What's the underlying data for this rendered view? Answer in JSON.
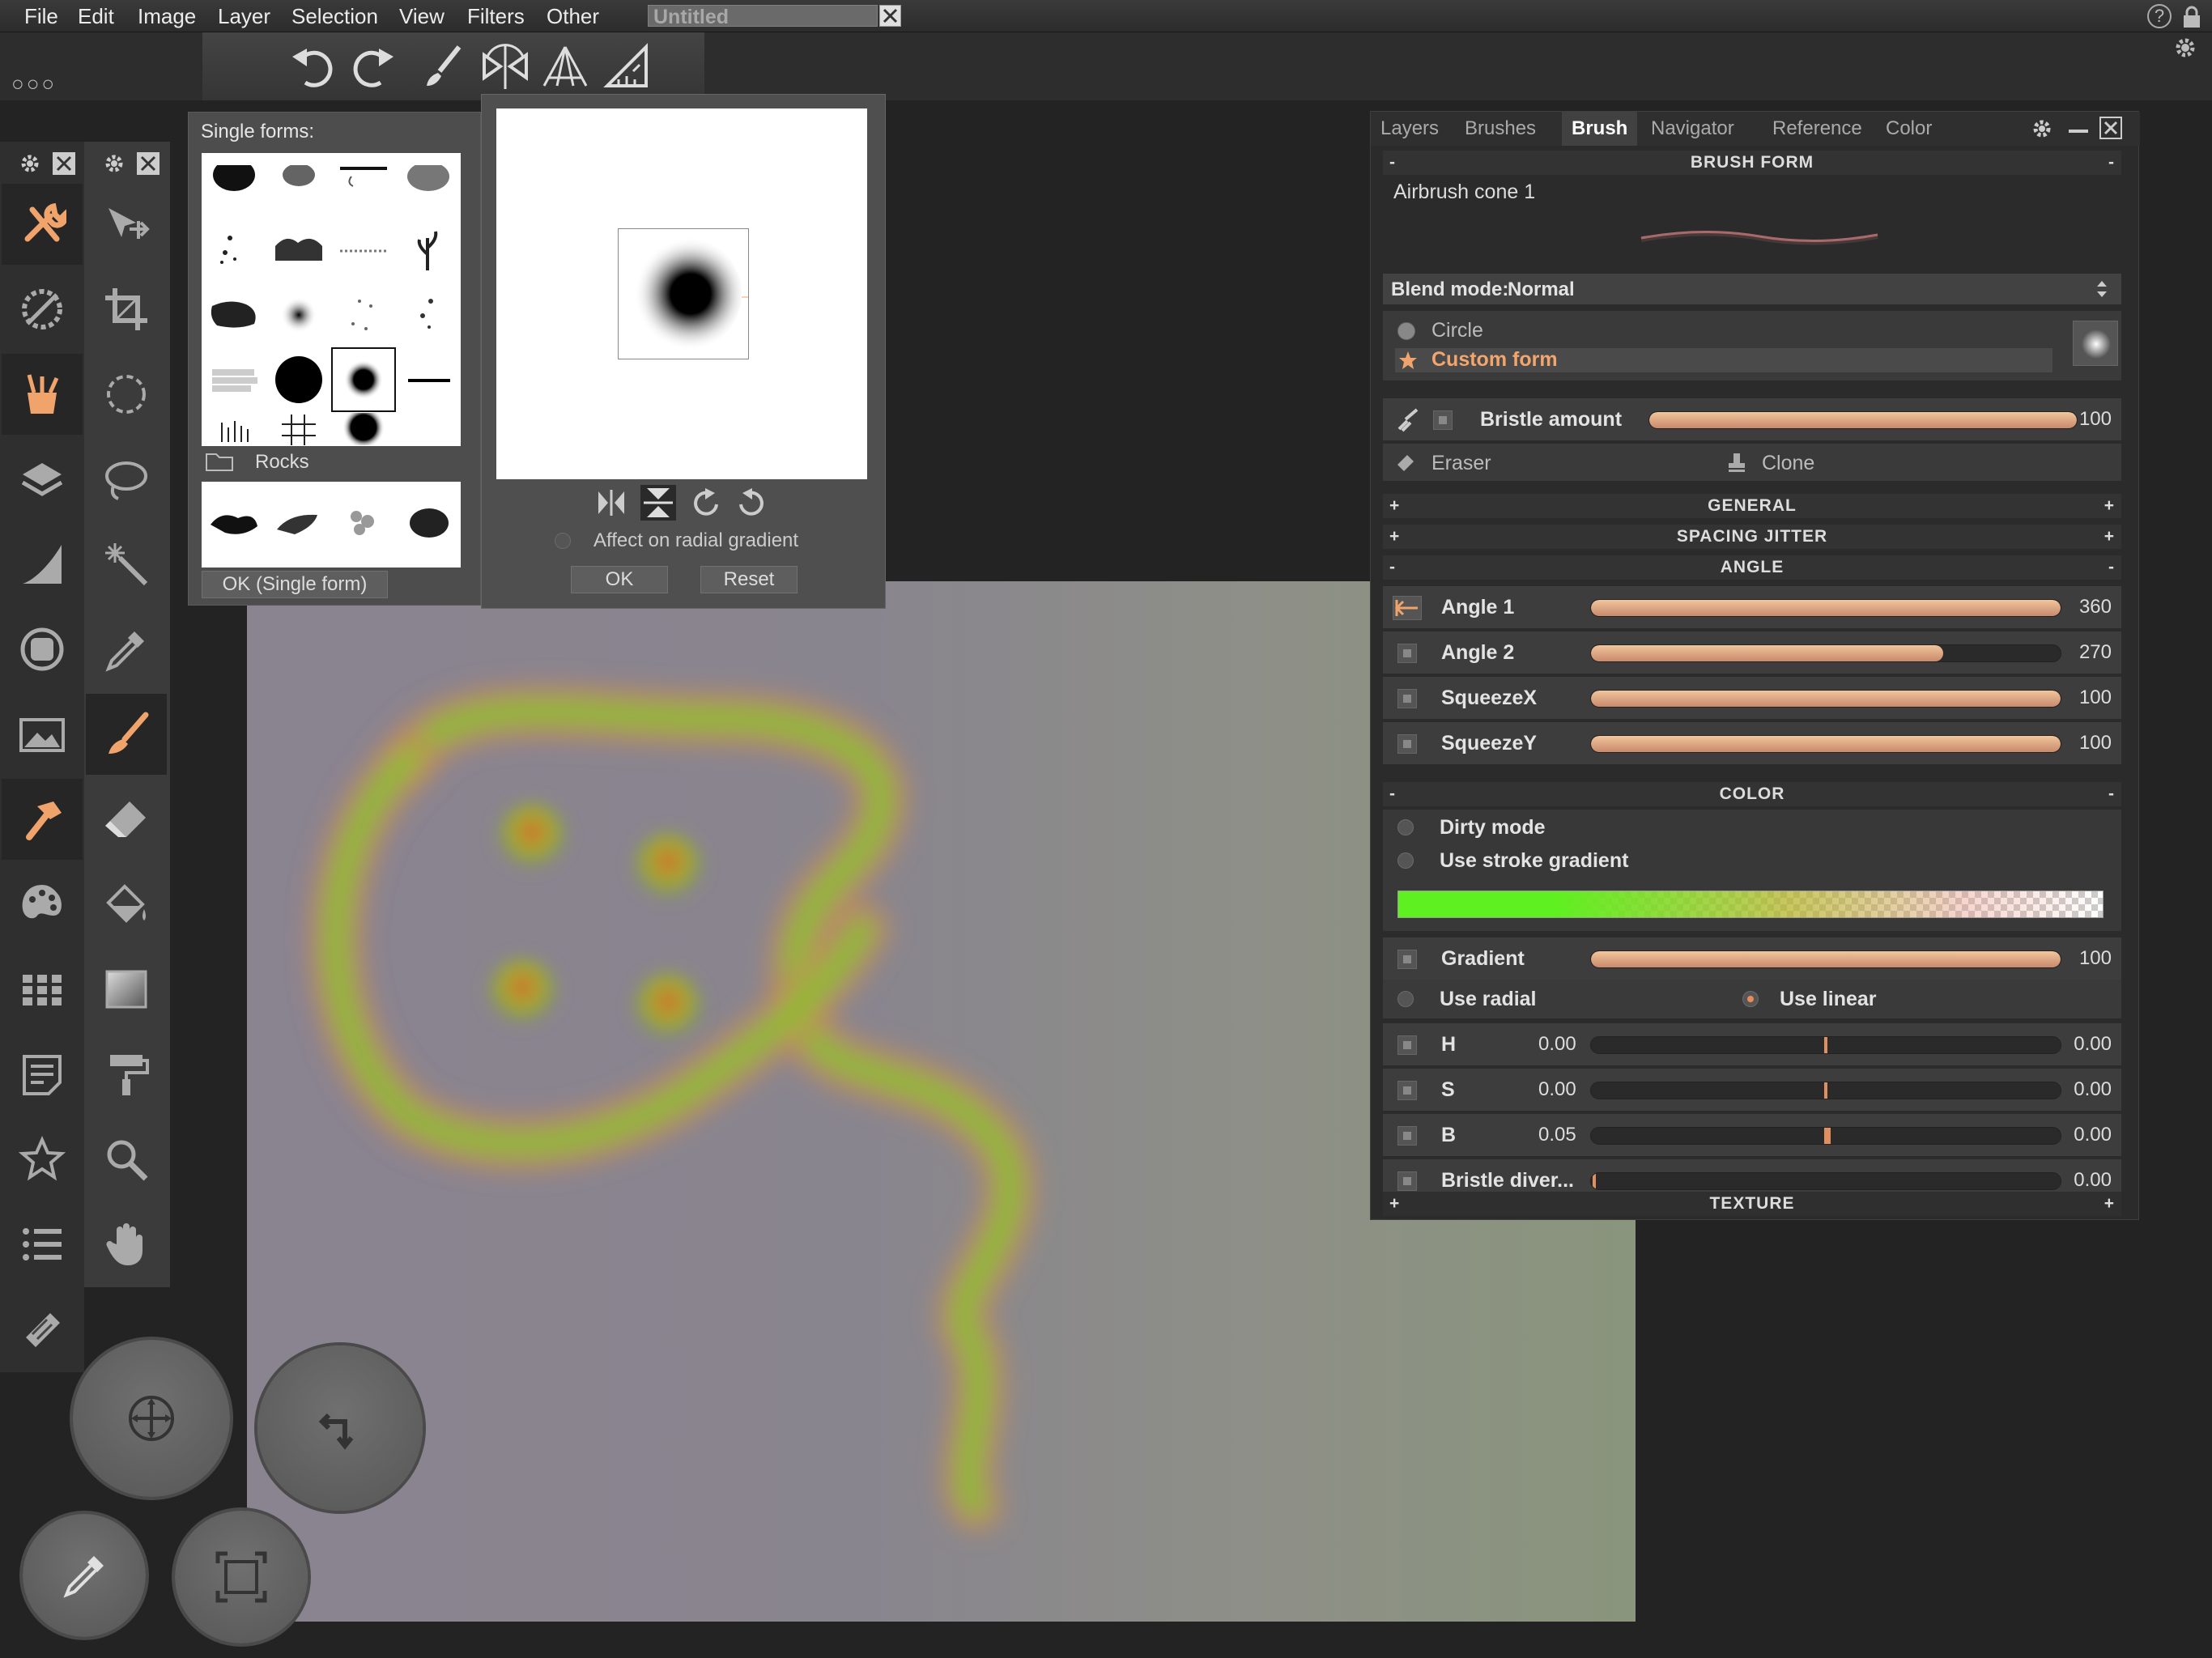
{
  "menu": {
    "items": [
      "File",
      "Edit",
      "Image",
      "Layer",
      "Selection",
      "View",
      "Filters",
      "Other"
    ],
    "document_title": "Untitled",
    "help_glyph": "?"
  },
  "toolbar": {
    "dots": "○○○",
    "icons": [
      "undo-icon",
      "redo-icon",
      "brush-icon",
      "symmetry-icon",
      "perspective-icon",
      "ruler-icon"
    ]
  },
  "left_tools": {
    "col1": [
      "tools-icon",
      "adjust-icon",
      "bucket-brushes-icon",
      "layers-icon",
      "curve-icon",
      "circle-filter-icon",
      "image-icon",
      "hammer-icon",
      "palette-icon",
      "grid-icon",
      "note-icon",
      "star-icon",
      "list-icon",
      "scroll-icon"
    ],
    "col2": [
      "move-icon",
      "crop-icon",
      "ellipse-select-icon",
      "lasso-icon",
      "magic-wand-icon",
      "eyedropper-icon",
      "brush-icon",
      "eraser-icon",
      "fill-icon",
      "gradient-icon",
      "paint-roller-icon",
      "zoom-icon",
      "hand-icon"
    ]
  },
  "forms_panel": {
    "title": "Single forms:",
    "folder_label": "Rocks",
    "ok_label": "OK (Single form)"
  },
  "preview_panel": {
    "affect_label": "Affect on radial gradient",
    "ok_label": "OK",
    "reset_label": "Reset"
  },
  "brush_panel": {
    "tabs": [
      "Layers",
      "Brushes",
      "Brush",
      "Navigator",
      "Reference",
      "Color"
    ],
    "active_tab": "Brush",
    "sections": {
      "brush_form": "BRUSH FORM",
      "general": "GENERAL",
      "spacing_jitter": "SPACING JITTER",
      "angle": "ANGLE",
      "color": "COLOR",
      "texture": "TEXTURE"
    },
    "brush_name": "Airbrush cone 1",
    "blend_mode_label": "Blend mode:",
    "blend_mode_value": "Normal",
    "form_circle": "Circle",
    "form_custom": "Custom form",
    "bristle_label": "Bristle amount",
    "bristle_value": "100",
    "bristle_fraction": 1.0,
    "eraser_label": "Eraser",
    "clone_label": "Clone",
    "angle_rows": [
      {
        "label": "Angle 1",
        "value": "360",
        "fraction": 1.0
      },
      {
        "label": "Angle 2",
        "value": "270",
        "fraction": 0.75
      },
      {
        "label": "SqueezeX",
        "value": "100",
        "fraction": 1.0
      },
      {
        "label": "SqueezeY",
        "value": "100",
        "fraction": 1.0
      }
    ],
    "dirty_mode": "Dirty mode",
    "use_stroke_gradient": "Use stroke gradient",
    "gradient_label": "Gradient",
    "gradient_value": "100",
    "gradient_fraction": 1.0,
    "use_radial": "Use radial",
    "use_linear": "Use linear",
    "hsb_rows": [
      {
        "label": "H",
        "left": "0.00",
        "right": "0.00",
        "fraction": 0.5
      },
      {
        "label": "S",
        "left": "0.00",
        "right": "0.00",
        "fraction": 0.5
      },
      {
        "label": "B",
        "left": "0.05",
        "right": "0.00",
        "fraction": 0.5
      }
    ],
    "bristle_diver_label": "Bristle diver...",
    "bristle_diver_value": "0.00",
    "accent_color": "#e8a070",
    "gradient_color": "#5ef020"
  }
}
